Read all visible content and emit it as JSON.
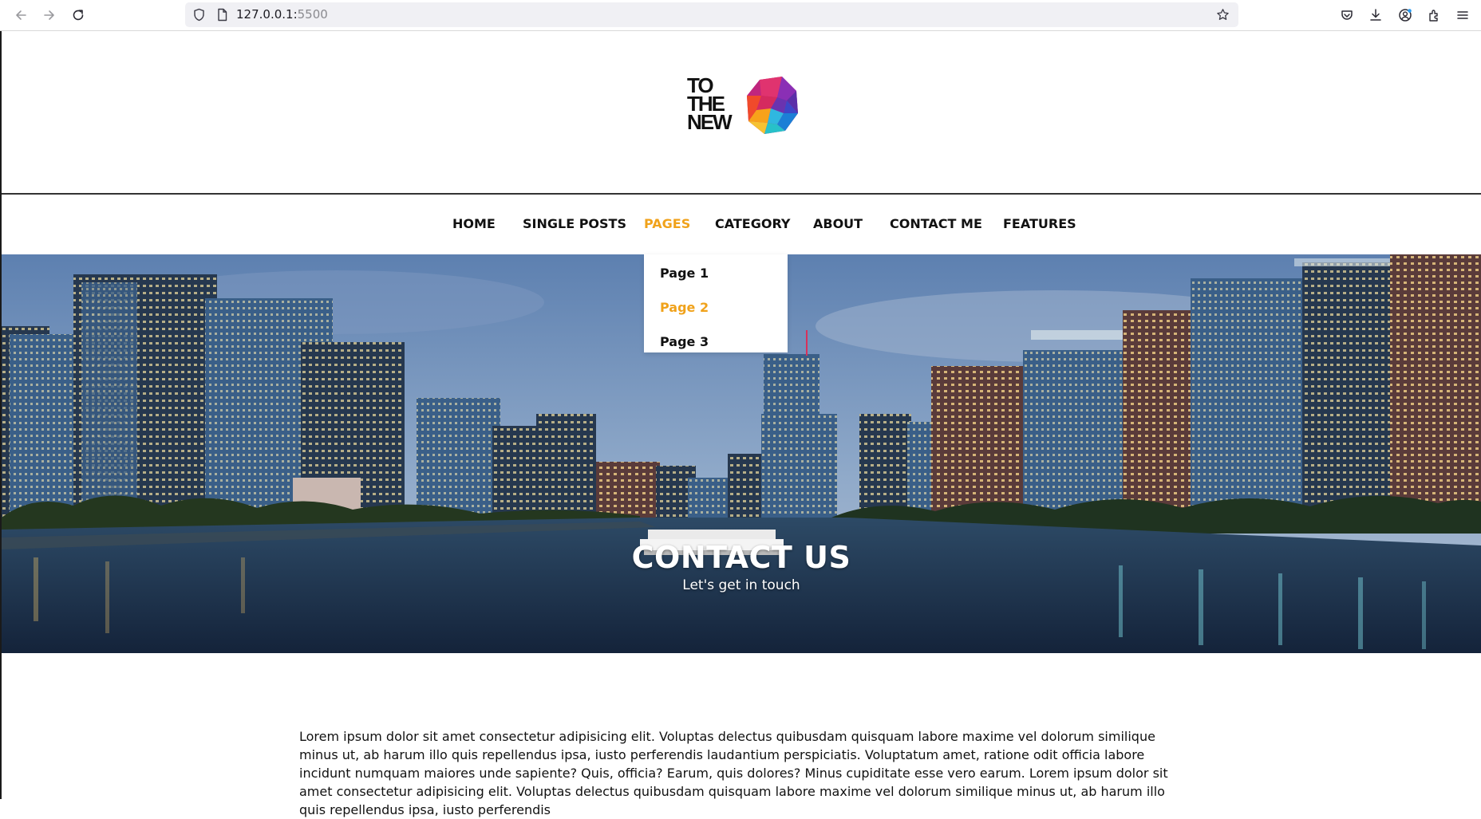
{
  "browser": {
    "url_host": "127.0.0.1:",
    "url_port": "5500",
    "icons": [
      "back-icon",
      "forward-icon",
      "reload-icon",
      "shield-icon",
      "page-icon",
      "bookmark-star-icon",
      "pocket-icon",
      "download-icon",
      "account-icon",
      "extensions-icon",
      "menu-icon"
    ]
  },
  "brand": {
    "line1": "TO",
    "line2": "THE",
    "line3": "NEW",
    "mark": "TO THE NEW logo"
  },
  "nav": {
    "items": [
      {
        "label": "HOME"
      },
      {
        "label": "SINGLE POSTS"
      },
      {
        "label": "PAGES"
      },
      {
        "label": "CATEGORY"
      },
      {
        "label": "ABOUT"
      },
      {
        "label": "CONTACT ME"
      },
      {
        "label": "FEATURES"
      }
    ],
    "active": "PAGES"
  },
  "dropdown": {
    "items": [
      {
        "label": "Page 1"
      },
      {
        "label": "Page 2"
      },
      {
        "label": "Page 3"
      }
    ],
    "highlighted": "Page 2"
  },
  "hero": {
    "title": "CONTACT US",
    "subtitle": "Let's get in touch"
  },
  "content": {
    "paragraph": "Lorem ipsum dolor sit amet consectetur adipisicing elit. Voluptas delectus quibusdam quisquam labore maxime vel dolorum similique minus ut, ab harum illo quis repellendus ipsa, iusto perferendis laudantium perspiciatis. Voluptatum amet, ratione odit officia labore incidunt numquam maiores unde sapiente? Quis, officia? Earum, quis dolores? Minus cupiditate esse vero earum. Lorem ipsum dolor sit amet consectetur adipisicing elit. Voluptas delectus quibusdam quisquam labore maxime vel dolorum similique minus ut, ab harum illo quis repellendus ipsa, iusto perferendis"
  },
  "colors": {
    "accent": "#f0a21b",
    "text": "#111111"
  }
}
